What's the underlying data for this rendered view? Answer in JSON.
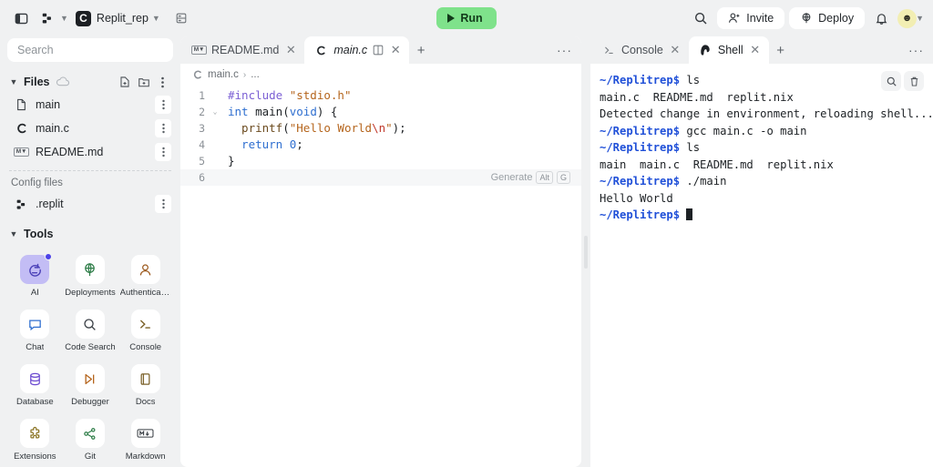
{
  "header": {
    "panel_toggle_icon": "sidebar-toggle-icon",
    "workspace_icon": "replit-nodes-icon",
    "repo_logo_letter": "C",
    "repo_name": "Replit_rep",
    "database_icon": "database-icon",
    "run_label": "Run",
    "search_icon": "search-icon",
    "invite_label": "Invite",
    "deploy_label": "Deploy",
    "bell_icon": "bell-icon",
    "avatar_glyph": "☻",
    "run_color": "#7fe28b"
  },
  "sidebar": {
    "search_placeholder": "Search",
    "files_section": {
      "title": "Files",
      "cloud_icon": "cloud-icon",
      "add_file_icon": "add-file-icon",
      "add_folder_icon": "add-folder-icon",
      "more_icon": "kebab-icon",
      "items": [
        {
          "name": "main",
          "icon": "file-icon"
        },
        {
          "name": "main.c",
          "icon": "c-lang-icon"
        },
        {
          "name": "README.md",
          "icon": "markdown-icon"
        }
      ]
    },
    "config_label": "Config files",
    "config_items": [
      {
        "name": ".replit",
        "icon": "replit-nodes-icon"
      }
    ],
    "tools_section": {
      "title": "Tools",
      "items": [
        {
          "label": "AI",
          "icon": "ai-icon",
          "active": true,
          "badge": true
        },
        {
          "label": "Deployments",
          "icon": "deployments-icon",
          "active": false,
          "badge": false
        },
        {
          "label": "Authenticati...",
          "icon": "authentication-icon",
          "active": false,
          "badge": false
        },
        {
          "label": "Chat",
          "icon": "chat-icon",
          "active": false,
          "badge": false
        },
        {
          "label": "Code Search",
          "icon": "code-search-icon",
          "active": false,
          "badge": false
        },
        {
          "label": "Console",
          "icon": "console-icon",
          "active": false,
          "badge": false
        },
        {
          "label": "Database",
          "icon": "database-icon",
          "active": false,
          "badge": false
        },
        {
          "label": "Debugger",
          "icon": "debugger-icon",
          "active": false,
          "badge": false
        },
        {
          "label": "Docs",
          "icon": "docs-icon",
          "active": false,
          "badge": false
        },
        {
          "label": "Extensions",
          "icon": "extensions-icon",
          "active": false,
          "badge": false
        },
        {
          "label": "Git",
          "icon": "git-icon",
          "active": false,
          "badge": false
        },
        {
          "label": "Markdown",
          "icon": "markdown-icon",
          "active": false,
          "badge": false
        }
      ]
    }
  },
  "editor": {
    "tabs": [
      {
        "label": "README.md",
        "icon": "markdown-icon",
        "active": false
      },
      {
        "label": "main.c",
        "icon": "c-lang-icon",
        "active": true
      }
    ],
    "new_tab_label": "+",
    "more_label": "···",
    "breadcrumb": {
      "file": "main.c",
      "separator": "›",
      "tail": "..."
    },
    "generate_hint": {
      "label": "Generate",
      "key1": "Alt",
      "key2": "G"
    },
    "lines": [
      {
        "num": "1",
        "fold": "",
        "tokens": [
          {
            "t": "#include ",
            "c": "k-pre"
          },
          {
            "t": "\"stdio.h\"",
            "c": "k-str"
          }
        ]
      },
      {
        "num": "2",
        "fold": "⌄",
        "tokens": [
          {
            "t": "int ",
            "c": "k-kw"
          },
          {
            "t": "main",
            "c": "k-plain"
          },
          {
            "t": "(",
            "c": "k-plain"
          },
          {
            "t": "void",
            "c": "k-kw"
          },
          {
            "t": ") {",
            "c": "k-plain"
          }
        ]
      },
      {
        "num": "3",
        "fold": "",
        "tokens": [
          {
            "t": "  printf",
            "c": "k-fn"
          },
          {
            "t": "(",
            "c": "k-plain"
          },
          {
            "t": "\"Hello World",
            "c": "k-str"
          },
          {
            "t": "\\n",
            "c": "k-esc"
          },
          {
            "t": "\"",
            "c": "k-str"
          },
          {
            "t": ");",
            "c": "k-plain"
          }
        ]
      },
      {
        "num": "4",
        "fold": "",
        "tokens": [
          {
            "t": "  return ",
            "c": "k-kw"
          },
          {
            "t": "0",
            "c": "k-num"
          },
          {
            "t": ";",
            "c": "k-plain"
          }
        ]
      },
      {
        "num": "5",
        "fold": "",
        "tokens": [
          {
            "t": "}",
            "c": "k-plain"
          }
        ]
      },
      {
        "num": "6",
        "fold": "",
        "tokens": []
      }
    ]
  },
  "shell": {
    "tabs": [
      {
        "label": "Console",
        "icon": "console-icon",
        "active": false
      },
      {
        "label": "Shell",
        "icon": "shell-icon",
        "active": true
      }
    ],
    "new_tab_label": "+",
    "more_label": "···",
    "search_icon": "search-icon",
    "trash_icon": "trash-icon",
    "prompt": "~/Replitrep$",
    "lines": [
      {
        "prompt": true,
        "text": " ls"
      },
      {
        "prompt": false,
        "text": "main.c  README.md  replit.nix"
      },
      {
        "prompt": false,
        "text": "Detected change in environment, reloading shell..."
      },
      {
        "prompt": true,
        "text": " gcc main.c -o main"
      },
      {
        "prompt": true,
        "text": " ls"
      },
      {
        "prompt": false,
        "text": "main  main.c  README.md  replit.nix"
      },
      {
        "prompt": true,
        "text": " ./main"
      },
      {
        "prompt": false,
        "text": "Hello World"
      },
      {
        "prompt": true,
        "text": " ",
        "cursor": true
      }
    ]
  }
}
